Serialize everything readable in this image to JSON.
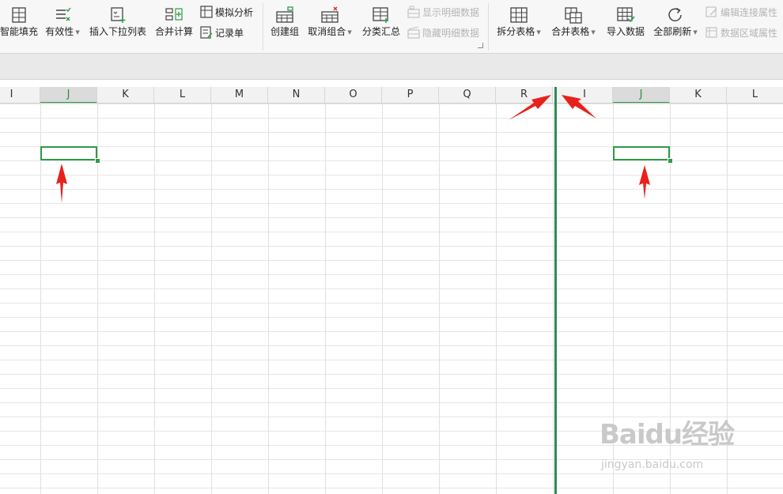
{
  "ribbon": {
    "buttons": [
      {
        "label": "智能填充",
        "dropdown": false,
        "enabled": true,
        "icon": "smart-fill-icon"
      },
      {
        "label": "有效性",
        "dropdown": true,
        "enabled": true,
        "icon": "validity-icon"
      },
      {
        "label": "插入下拉列表",
        "dropdown": false,
        "enabled": true,
        "icon": "insert-dropdown-list-icon"
      },
      {
        "label": "合并计算",
        "dropdown": false,
        "enabled": true,
        "icon": "consolidate-icon"
      },
      {
        "label": "创建组",
        "dropdown": false,
        "enabled": true,
        "icon": "create-group-icon"
      },
      {
        "label": "取消组合",
        "dropdown": true,
        "enabled": true,
        "icon": "ungroup-icon"
      },
      {
        "label": "分类汇总",
        "dropdown": false,
        "enabled": true,
        "icon": "subtotal-icon"
      },
      {
        "label": "拆分表格",
        "dropdown": true,
        "enabled": true,
        "icon": "split-table-icon"
      },
      {
        "label": "合并表格",
        "dropdown": true,
        "enabled": true,
        "icon": "merge-table-icon"
      },
      {
        "label": "导入数据",
        "dropdown": false,
        "enabled": true,
        "icon": "import-data-icon"
      },
      {
        "label": "全部刷新",
        "dropdown": true,
        "enabled": true,
        "icon": "refresh-icon"
      }
    ],
    "small_buttons": [
      {
        "label": "模拟分析",
        "dropdown": false,
        "enabled": true,
        "icon": "what-if-analysis-icon"
      },
      {
        "label": "记录单",
        "dropdown": false,
        "enabled": true,
        "icon": "record-form-icon"
      },
      {
        "label": "显示明细数据",
        "dropdown": false,
        "enabled": false,
        "icon": "show-detail-icon"
      },
      {
        "label": "隐藏明细数据",
        "dropdown": false,
        "enabled": false,
        "icon": "hide-detail-icon"
      },
      {
        "label": "编辑连接属性",
        "dropdown": false,
        "enabled": false,
        "icon": "edit-connection-icon"
      },
      {
        "label": "数据区域属性",
        "dropdown": false,
        "enabled": false,
        "icon": "data-range-properties-icon"
      }
    ]
  },
  "left_pane": {
    "columns": [
      "I",
      "J",
      "K",
      "L",
      "M",
      "N",
      "O",
      "P",
      "Q",
      "R"
    ],
    "selected_column": "J"
  },
  "right_pane": {
    "columns": [
      "I",
      "J",
      "K",
      "L"
    ],
    "selected_column": "J"
  },
  "watermark": {
    "logo": "Baidu经验",
    "url": "jingyan.baidu.com"
  },
  "colors": {
    "accent": "#2e8b57",
    "selection": "#2f9a48",
    "annotation_arrow": "#e8211b"
  }
}
